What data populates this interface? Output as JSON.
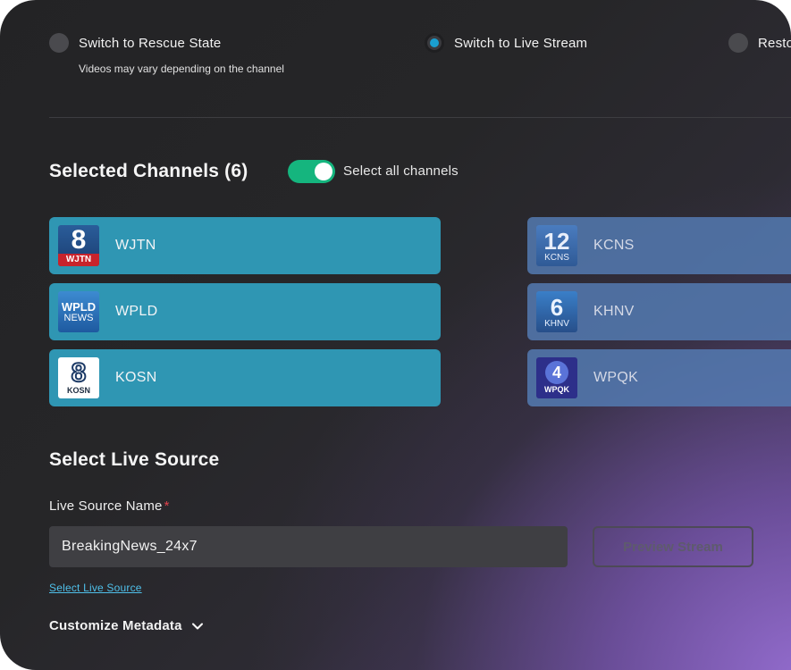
{
  "modes": [
    {
      "label": "Switch to Rescue State",
      "selected": false
    },
    {
      "label": "Switch to Live Stream",
      "selected": true
    },
    {
      "label": "Resto",
      "selected": false
    }
  ],
  "modes_hint": "Videos may vary depending on the channel",
  "channels_section": {
    "title": "Selected Channels (6)",
    "select_all_label": "Select all channels",
    "select_all_on": true
  },
  "channels": [
    {
      "name": "WJTN",
      "logo_main": "8",
      "logo_sub": "WJTN"
    },
    {
      "name": "KCNS",
      "logo_main": "12",
      "logo_sub": "KCNS"
    },
    {
      "name": "WPLD",
      "logo_main": "WPLD",
      "logo_sub": "NEWS"
    },
    {
      "name": "KHNV",
      "logo_main": "6",
      "logo_sub": "KHNV"
    },
    {
      "name": "KOSN",
      "logo_main": "8",
      "logo_sub": "KOSN"
    },
    {
      "name": "WPQK",
      "logo_main": "4",
      "logo_sub": "WPQK"
    }
  ],
  "live_source": {
    "title": "Select Live Source",
    "field_label": "Live Source Name",
    "required_mark": "*",
    "value": "BreakingNews_24x7",
    "preview_button": "Preview Stream",
    "select_link": "Select Live Source",
    "metadata_label": "Customize Metadata"
  },
  "colors": {
    "toggle_on": "#15b57e",
    "channel_card": "#2f96b3",
    "radio_active": "#1a9fd0",
    "link": "#4fc0ea",
    "required": "#e0414b"
  },
  "icons": [
    "chevron-down-icon"
  ]
}
